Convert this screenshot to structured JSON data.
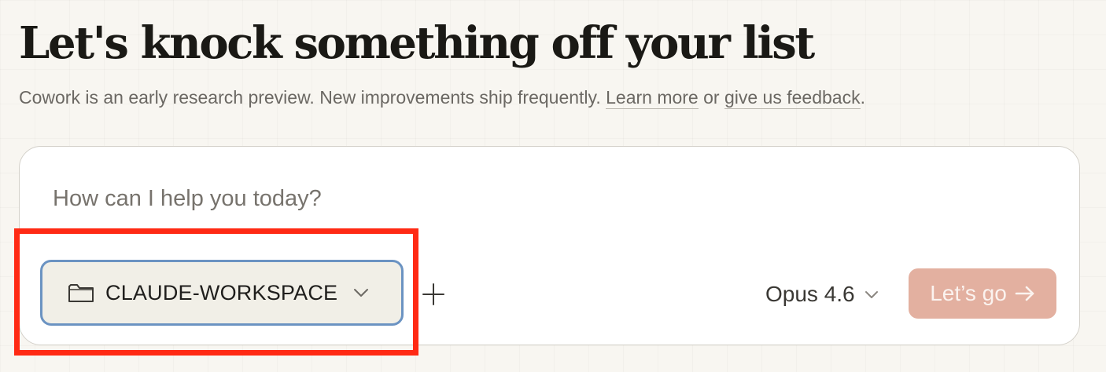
{
  "header": {
    "title": "Let's knock something off your list",
    "subtitle_text": "Cowork is an early research preview. New improvements ship frequently.",
    "learn_more_label": "Learn more",
    "or_text": "or",
    "feedback_label": "give us feedback",
    "period": "."
  },
  "composer": {
    "placeholder": "How can I help you today?",
    "folder": {
      "icon": "folder-icon",
      "label": "CLAUDE-WORKSPACE",
      "chevron_icon": "chevron-down-icon"
    },
    "add_icon": "plus-icon",
    "model": {
      "label": "Opus 4.6",
      "chevron_icon": "chevron-down-icon"
    },
    "submit": {
      "label": "Let’s go",
      "icon": "arrow-right-icon"
    }
  },
  "colors": {
    "background": "#f8f6f1",
    "composer_bg": "#ffffff",
    "folder_button_bg": "#f1efe7",
    "folder_focus_ring": "#6b93c2",
    "submit_bg": "#e3b0a0",
    "highlight": "#ff2a14"
  }
}
